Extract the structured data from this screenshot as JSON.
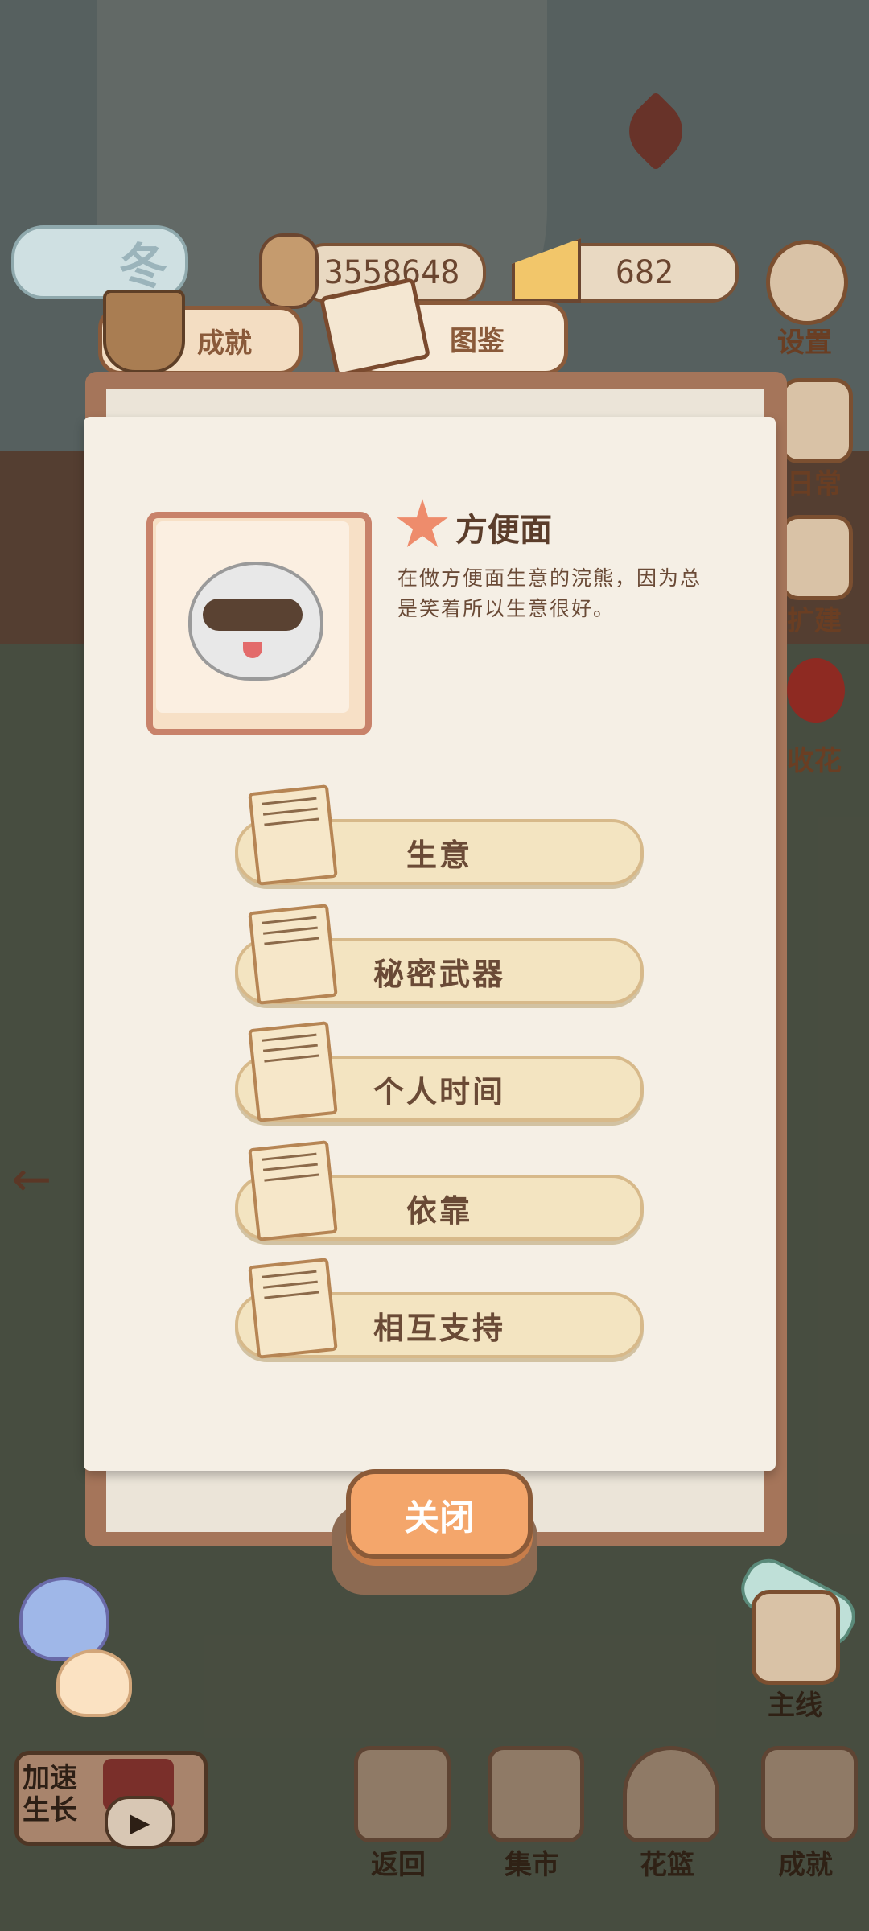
{
  "season": {
    "label": "冬"
  },
  "currency": {
    "fish_bones": "3558648",
    "cheese": "682"
  },
  "tabs": [
    {
      "label": "成就"
    },
    {
      "label": "图鉴"
    }
  ],
  "side_menu": [
    {
      "label": "设置"
    },
    {
      "label": "日常"
    },
    {
      "label": "扩建"
    },
    {
      "label": "收花"
    }
  ],
  "character": {
    "name": "方便面",
    "description": "在做方便面生意的浣熊，因为总是笑着所以生意很好。"
  },
  "entries": [
    {
      "label": "生意"
    },
    {
      "label": "秘密武器"
    },
    {
      "label": "个人时间"
    },
    {
      "label": "依靠"
    },
    {
      "label": "相互支持"
    }
  ],
  "close_button": {
    "label": "关闭"
  },
  "speed_up": {
    "label": "加速生长"
  },
  "main_quest": {
    "label": "主线"
  },
  "bottom_nav": [
    {
      "label": "返回"
    },
    {
      "label": "集市"
    },
    {
      "label": "花篮"
    },
    {
      "label": "成就"
    }
  ]
}
